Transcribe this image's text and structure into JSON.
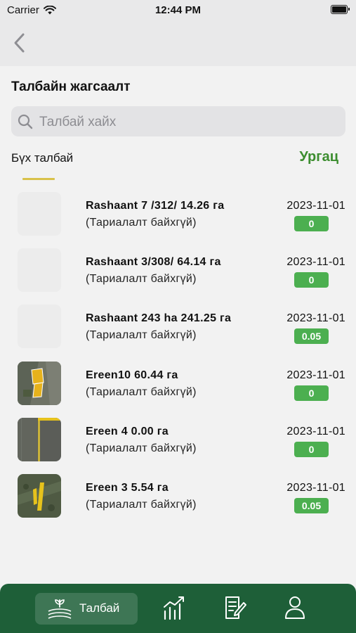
{
  "status_bar": {
    "carrier": "Carrier",
    "time": "12:44 PM"
  },
  "header": {
    "title": "Талбайн жагсаалт"
  },
  "search": {
    "placeholder": "Талбай хайх",
    "value": ""
  },
  "filters": {
    "all_label": "Бүх талбай",
    "crop_label": "Ургац"
  },
  "fields": [
    {
      "name": "Rashaant 7 /312/ 14.26 га",
      "status": "(Тариалалт байхгүй)",
      "date": "2023-11-01",
      "value": "0"
    },
    {
      "name": "Rashaant 3/308/ 64.14 га",
      "status": "(Тариалалт байхгүй)",
      "date": "2023-11-01",
      "value": "0"
    },
    {
      "name": "Rashaant 243 ha 241.25 га",
      "status": "(Тариалалт байхгүй)",
      "date": "2023-11-01",
      "value": "0.05"
    },
    {
      "name": "Ereen10 60.44 га",
      "status": "(Тариалалт байхгүй)",
      "date": "2023-11-01",
      "value": "0"
    },
    {
      "name": "Ereen 4 0.00 га",
      "status": "(Тариалалт байхгүй)",
      "date": "2023-11-01",
      "value": "0"
    },
    {
      "name": "Ereen 3 5.54 га",
      "status": "(Тариалалт байхгүй)",
      "date": "2023-11-01",
      "value": "0.05"
    }
  ],
  "tabbar": {
    "active_label": "Талбай"
  },
  "colors": {
    "accent_green": "#3c8d2f",
    "badge_green": "#4caf50",
    "tabbar_bg": "#1e5f38"
  }
}
